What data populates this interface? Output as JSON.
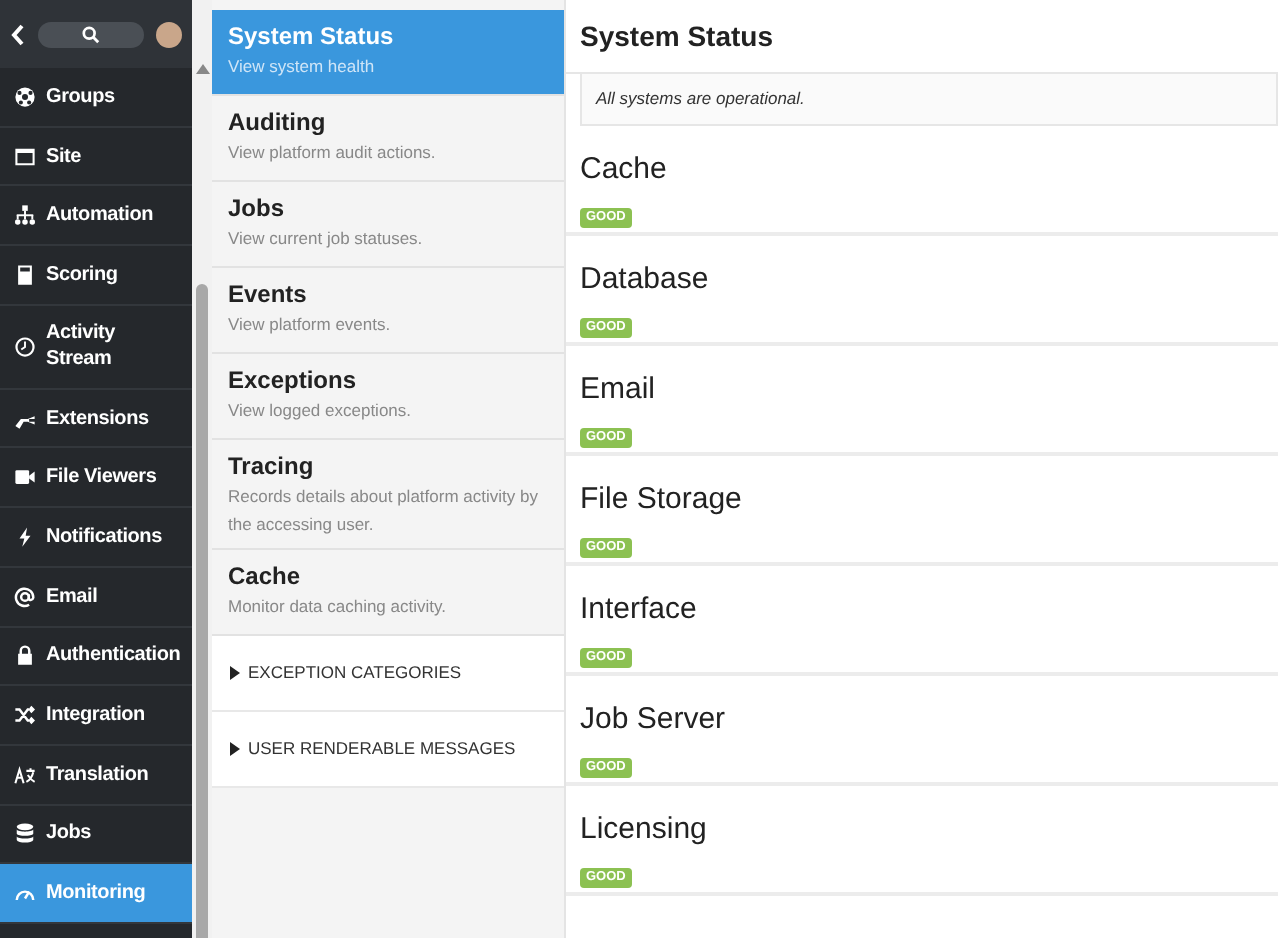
{
  "sidebar": {
    "items": [
      {
        "label": "Groups",
        "selected": false
      },
      {
        "label": "Site",
        "selected": false
      },
      {
        "label": "Automation",
        "selected": false
      },
      {
        "label": "Scoring",
        "selected": false
      },
      {
        "label": "Activity Stream",
        "selected": false
      },
      {
        "label": "Extensions",
        "selected": false
      },
      {
        "label": "File Viewers",
        "selected": false
      },
      {
        "label": "Notifications",
        "selected": false
      },
      {
        "label": "Email",
        "selected": false
      },
      {
        "label": "Authentication",
        "selected": false
      },
      {
        "label": "Integration",
        "selected": false
      },
      {
        "label": "Translation",
        "selected": false
      },
      {
        "label": "Jobs",
        "selected": false
      },
      {
        "label": "Monitoring",
        "selected": true
      }
    ]
  },
  "subnav": {
    "items": [
      {
        "title": "System Status",
        "description": "View system health",
        "selected": true
      },
      {
        "title": "Auditing",
        "description": "View platform audit actions.",
        "selected": false
      },
      {
        "title": "Jobs",
        "description": "View current job statuses.",
        "selected": false
      },
      {
        "title": "Events",
        "description": "View platform events.",
        "selected": false
      },
      {
        "title": "Exceptions",
        "description": "View logged exceptions.",
        "selected": false
      },
      {
        "title": "Tracing",
        "description": "Records details about platform activity by the accessing user.",
        "selected": false
      },
      {
        "title": "Cache",
        "description": "Monitor data caching activity.",
        "selected": false
      }
    ],
    "sections": [
      {
        "label": "EXCEPTION CATEGORIES",
        "expanded": false
      },
      {
        "label": "USER RENDERABLE MESSAGES",
        "expanded": false
      }
    ]
  },
  "main": {
    "title": "System Status",
    "message": "All systems are operational.",
    "components": [
      {
        "name": "Cache",
        "status": "GOOD",
        "kind": "good"
      },
      {
        "name": "Database",
        "status": "GOOD",
        "kind": "good"
      },
      {
        "name": "Email",
        "status": "GOOD",
        "kind": "good"
      },
      {
        "name": "File Storage",
        "status": "GOOD",
        "kind": "good"
      },
      {
        "name": "Interface",
        "status": "GOOD",
        "kind": "good"
      },
      {
        "name": "Job Server",
        "status": "GOOD",
        "kind": "good"
      },
      {
        "name": "Licensing",
        "status": "GOOD",
        "kind": "good"
      }
    ]
  }
}
